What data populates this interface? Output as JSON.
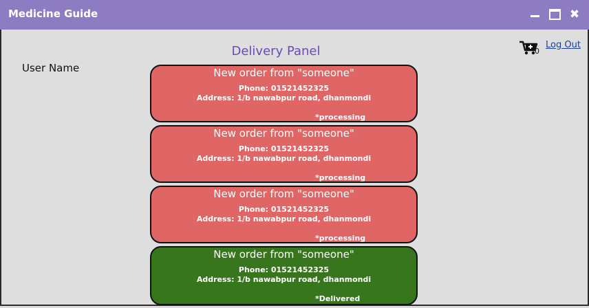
{
  "window": {
    "title": "Medicine Guide",
    "controls": {
      "minimize": "minimize",
      "maximize": "maximize",
      "close": "✖"
    }
  },
  "header": {
    "panel_title": "Delivery Panel",
    "user_name": "User Name",
    "cart_count": "0",
    "logout_label": "Log Out"
  },
  "orders": [
    {
      "heading": "New order from \"someone\"",
      "phone": "Phone: 01521452325",
      "address": "Address: 1/b nawabpur road, dhanmondi",
      "status": "*processing"
    },
    {
      "heading": "New order from \"someone\"",
      "phone": "Phone: 01521452325",
      "address": "Address: 1/b nawabpur road, dhanmondi",
      "status": "*processing"
    },
    {
      "heading": "New order from \"someone\"",
      "phone": "Phone: 01521452325",
      "address": "Address: 1/b nawabpur road, dhanmondi",
      "status": "*processing"
    },
    {
      "heading": "New order from \"someone\"",
      "phone": "Phone: 01521452325",
      "address": "Address: 1/b nawabpur road, dhanmondi",
      "status": "*Delivered"
    }
  ],
  "colors": {
    "titlebar": "#8e7cc3",
    "processing": "#e06666",
    "delivered": "#38761d",
    "panel_title": "#6a4bb5"
  },
  "icons": {
    "cart": "cart-icon"
  }
}
